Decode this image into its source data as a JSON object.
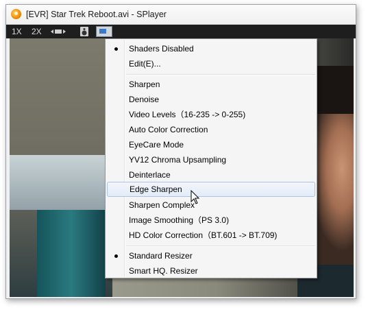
{
  "window": {
    "title": "[EVR] Star Trek Reboot.avi - SPlayer",
    "app_icon": "splayer-logo-icon"
  },
  "controlbar": {
    "speed_1x": "1X",
    "speed_2x": "2X",
    "items": [
      "aspect-icon",
      "speaker-icon",
      "display-settings-icon"
    ]
  },
  "menu": {
    "items": [
      {
        "label": "Shaders Disabled",
        "checked": true
      },
      {
        "label": "Edit(E)..."
      },
      {
        "label": "Sharpen"
      },
      {
        "label": "Denoise"
      },
      {
        "label": "Video Levels（16-235 -> 0-255)"
      },
      {
        "label": "Auto Color Correction"
      },
      {
        "label": "EyeCare Mode"
      },
      {
        "label": "YV12 Chroma Upsampling"
      },
      {
        "label": "Deinterlace"
      },
      {
        "label": "Edge Sharpen",
        "highlighted": true
      },
      {
        "label": "Sharpen Complex"
      },
      {
        "label": "Image Smoothing（PS 3.0)"
      },
      {
        "label": "HD Color Correction（BT.601 -> BT.709)"
      },
      {
        "label": "Standard Resizer",
        "checked": true
      },
      {
        "label": "Smart HQ. Resizer"
      }
    ]
  },
  "colors": {
    "menu_bg": "#f5f5f5",
    "highlight_border": "#a9c3e6",
    "controlbar_bg": "#1e1e1e"
  }
}
